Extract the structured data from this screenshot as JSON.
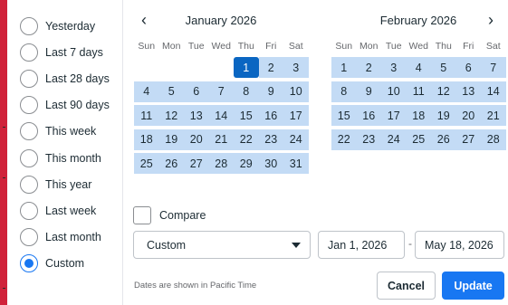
{
  "presets": [
    {
      "label": "Yesterday",
      "selected": false
    },
    {
      "label": "Last 7 days",
      "selected": false
    },
    {
      "label": "Last 28 days",
      "selected": false
    },
    {
      "label": "Last 90 days",
      "selected": false
    },
    {
      "label": "This week",
      "selected": false
    },
    {
      "label": "This month",
      "selected": false
    },
    {
      "label": "This year",
      "selected": false
    },
    {
      "label": "Last week",
      "selected": false
    },
    {
      "label": "Last month",
      "selected": false
    },
    {
      "label": "Custom",
      "selected": true
    }
  ],
  "calendar": {
    "prev_icon": "‹",
    "next_icon": "›",
    "weekdays": [
      "Sun",
      "Mon",
      "Tue",
      "Wed",
      "Thu",
      "Fri",
      "Sat"
    ],
    "months": [
      {
        "title": "January 2026",
        "first_weekday": 4,
        "days": [
          "1",
          "2",
          "3",
          "4",
          "5",
          "6",
          "7",
          "8",
          "9",
          "10",
          "11",
          "12",
          "13",
          "14",
          "15",
          "16",
          "17",
          "18",
          "19",
          "20",
          "21",
          "22",
          "23",
          "24",
          "25",
          "26",
          "27",
          "28",
          "29",
          "30",
          "31"
        ]
      },
      {
        "title": "February 2026",
        "first_weekday": 0,
        "days": [
          "1",
          "2",
          "3",
          "4",
          "5",
          "6",
          "7",
          "8",
          "9",
          "10",
          "11",
          "12",
          "13",
          "14",
          "15",
          "16",
          "17",
          "18",
          "19",
          "20",
          "21",
          "22",
          "23",
          "24",
          "25",
          "26",
          "27",
          "28"
        ]
      }
    ],
    "selected_start": {
      "month": 0,
      "day": 1
    }
  },
  "compare": {
    "label": "Compare",
    "checked": false
  },
  "range_select": {
    "value": "Custom"
  },
  "start_date": "Jan 1, 2026",
  "end_date": "May 18, 2026",
  "separator": "-",
  "footnote": "Dates are shown in Pacific Time",
  "buttons": {
    "cancel": "Cancel",
    "update": "Update"
  },
  "colors": {
    "accent": "#1877f2",
    "selected_day": "#0a66c2",
    "range_fill": "#c3dbf5",
    "background_edge": "#d0223a"
  }
}
